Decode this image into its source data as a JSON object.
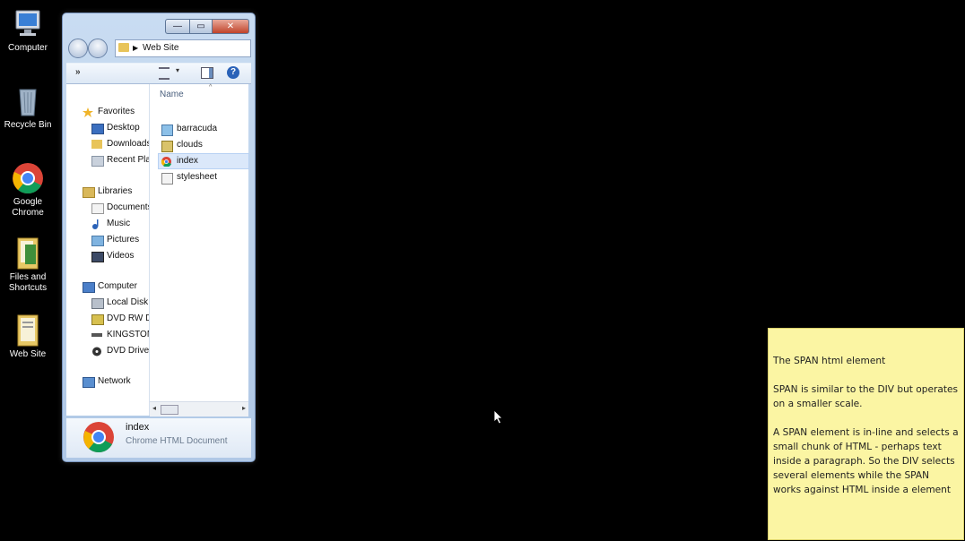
{
  "desktop": {
    "icons": [
      {
        "label": "Computer",
        "icon": "computer-icon"
      },
      {
        "label": "Recycle Bin",
        "icon": "recycle-bin-icon"
      },
      {
        "label": "Google Chrome",
        "icon": "chrome-icon"
      },
      {
        "label": "Files and Shortcuts",
        "icon": "folder-icon"
      },
      {
        "label": "Web Site",
        "icon": "folder-icon"
      }
    ]
  },
  "explorer": {
    "address": "Web Site",
    "toolbar": {
      "overflow": "»",
      "views_dropdown": "▾",
      "help": "?"
    },
    "nav": {
      "favorites": {
        "label": "Favorites",
        "items": [
          "Desktop",
          "Downloads",
          "Recent Places"
        ]
      },
      "libraries": {
        "label": "Libraries",
        "items": [
          "Documents",
          "Music",
          "Pictures",
          "Videos"
        ]
      },
      "computer": {
        "label": "Computer",
        "items": [
          "Local Disk",
          "DVD RW D",
          "KINGSTON",
          "DVD Drive"
        ]
      },
      "network": {
        "label": "Network"
      }
    },
    "column_header": "Name",
    "files": [
      {
        "name": "barracuda",
        "icon": "image-file-icon"
      },
      {
        "name": "clouds",
        "icon": "image-file-icon"
      },
      {
        "name": "index",
        "icon": "chrome-file-icon",
        "selected": true
      },
      {
        "name": "stylesheet",
        "icon": "css-file-icon"
      }
    ],
    "details": {
      "name": "index",
      "type": "Chrome HTML Document"
    }
  },
  "note": {
    "paragraphs": [
      "The SPAN html element",
      "SPAN is similar to the DIV but operates on a smaller scale.",
      "A SPAN element is in-line and selects a small chunk of HTML - perhaps text inside a paragraph.  So the DIV selects several elements while the SPAN works against HTML inside a element"
    ]
  },
  "colors": {
    "desktop_bg": "#000000",
    "note_bg": "#fbf5a3",
    "window_frame": "#c9dcf2",
    "selection": "#dbe8fa"
  }
}
